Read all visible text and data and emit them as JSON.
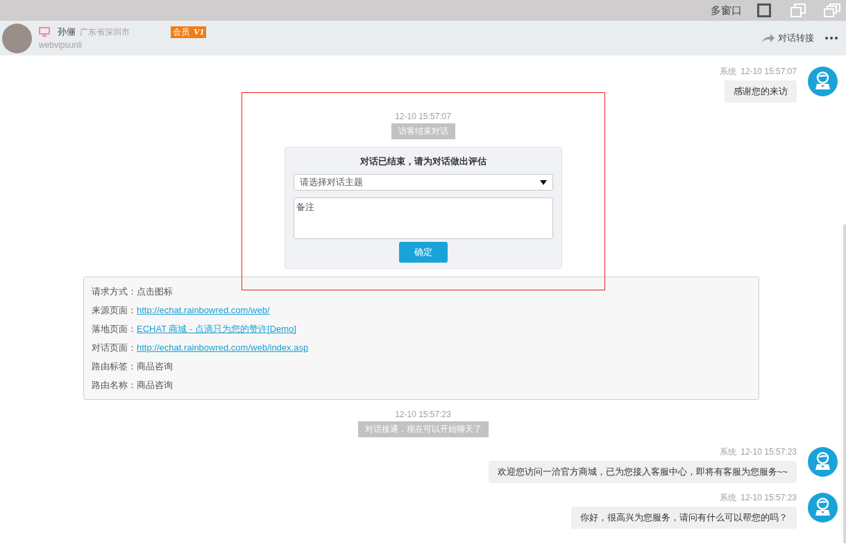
{
  "window": {
    "title": "多窗口"
  },
  "visitor": {
    "name": "孙俪",
    "location": "广东省深圳市",
    "account": "webvipsunli",
    "badge": "会员",
    "level_badge": "V1"
  },
  "header_actions": [
    {
      "label": "对话转接"
    }
  ],
  "messages": [
    {
      "kind": "agent",
      "sender": "系统",
      "time": "12-10 15:57:07",
      "text": "感谢您的来访"
    },
    {
      "kind": "event",
      "time": "12-10 15:57:07",
      "text": "访客结束对话",
      "highlighted": true
    },
    {
      "kind": "survey",
      "title": "对话已结束，请为对话做出评估",
      "select_placeholder": "请选择对话主题",
      "note_placeholder": "备注",
      "button": "确定"
    },
    {
      "kind": "info",
      "rows": [
        {
          "label": "请求方式：",
          "value": "点击图标",
          "link": false
        },
        {
          "label": "来源页面：",
          "value": "http://echat.rainbowred.com/web/",
          "link": true
        },
        {
          "label": "落地页面：",
          "value": "ECHAT 商城 - 点滴只为您的赞许[Demo]",
          "link": true
        },
        {
          "label": "对话页面：",
          "value": "http://echat.rainbowred.com/web/index.asp",
          "link": true
        },
        {
          "label": "路由标签：",
          "value": "商品咨询",
          "link": false
        },
        {
          "label": "路由名称：",
          "value": "商品咨询",
          "link": false
        }
      ]
    },
    {
      "kind": "event",
      "time": "12-10 15:57:23",
      "text": "对话接通，现在可以开始聊天了",
      "highlighted": false
    },
    {
      "kind": "agent",
      "sender": "系统",
      "time": "12-10 15:57:23",
      "text": "欢迎您访问一洽官方商城，已为您接入客服中心，即将有客服为您服务~~"
    },
    {
      "kind": "agent",
      "sender": "系统",
      "time": "12-10 15:57:23",
      "text": "你好，很高兴为您服务，请问有什么可以帮您的吗？"
    }
  ]
}
